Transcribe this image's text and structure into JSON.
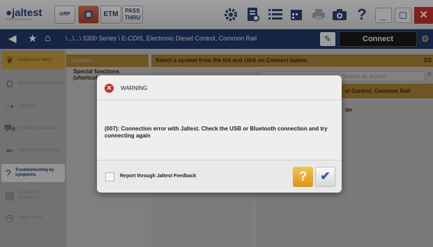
{
  "toolbar": {
    "logo": "jaltest",
    "logo_sub": "DIAGNOSTICS",
    "grp_label": "GRP",
    "etm_label": "ETM",
    "pass_thru_line1": "PASS",
    "pass_thru_line2": "THRU",
    "help_glyph": "?",
    "minimize_glyph": "_",
    "maximize_glyph": "☐",
    "close_glyph": "✕"
  },
  "nav": {
    "breadcrumb": "\\...\\...\\ 5300 Series \\ E-CDIS, Electronic Diesel Control, Common Rail",
    "connect_label": "Connect"
  },
  "sidebar": {
    "items": [
      {
        "label": "Diagnostics menu",
        "icon": "stethoscope-icon"
      },
      {
        "label": "Technical technical data",
        "icon": "omega-icon"
      },
      {
        "label": "Diagrams",
        "icon": "diagram-icon"
      },
      {
        "label": "Vehicle systems data",
        "icon": "truck-icon"
      },
      {
        "label": "Vehicle technical data",
        "icon": "wrench-icon"
      },
      {
        "label": "Troubleshooting by symptoms",
        "icon": "troubleshooting-icon"
      },
      {
        "label": "Overview and Procedures",
        "icon": "book-icon"
      },
      {
        "label": "Repair Times",
        "icon": "clock-icon"
      }
    ]
  },
  "main": {
    "col1_header": "Systems",
    "col1_item": "Special functions (shortcuts)",
    "col2_header": "Select a system from the list and click on Connect button",
    "paging": "2/2",
    "search_placeholder": "Search by actions",
    "system_row": "el Control, Common Rail",
    "ter_row": "ter"
  },
  "dialog": {
    "title": "WARNING",
    "message": "(007): Connection error with Jaltest. Check the USB or Bluetooth connection and try connecting again",
    "checkbox_label": "Report through Jaltest Feedback",
    "help_label": "?",
    "ok_label": "✔"
  },
  "colors": {
    "nav_blue": "#233a6a",
    "gold": "#a98336",
    "warning_red": "#c62f2f",
    "help_orange": "#e8a72a"
  }
}
